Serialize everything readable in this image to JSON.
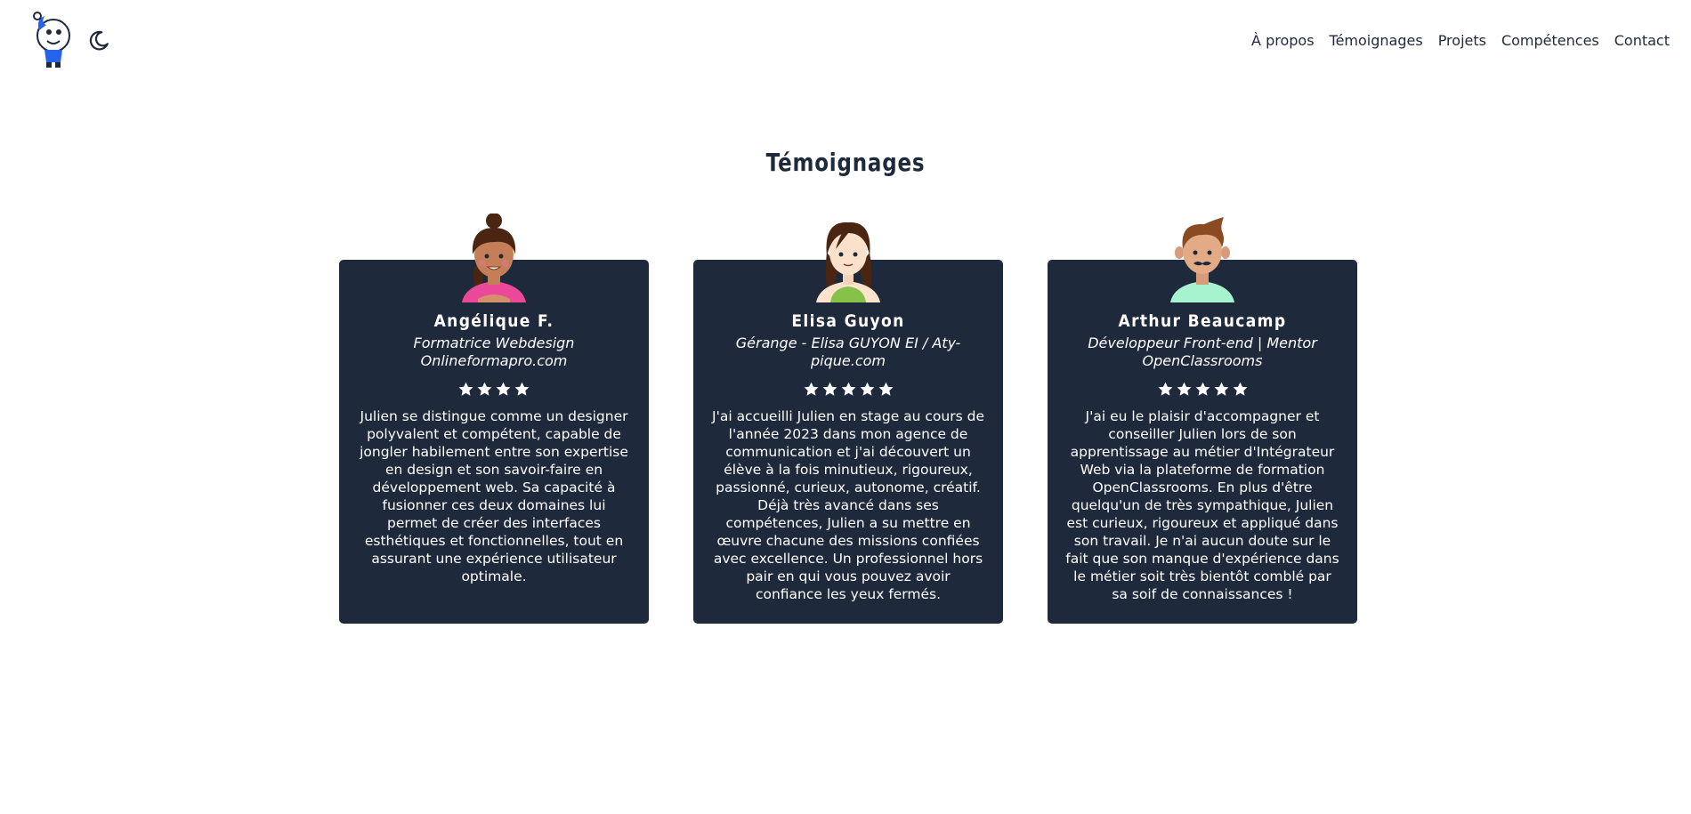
{
  "header": {
    "logo_icon": "cartoon-mascot-logo",
    "theme_icon": "moon-icon",
    "nav": [
      "À propos",
      "Témoignages",
      "Projets",
      "Compétences",
      "Contact"
    ]
  },
  "testimonials": {
    "title": "Témoignages",
    "cards": [
      {
        "avatar_icon": "woman-bun-avatar",
        "name": "Angélique F.",
        "role": "Formatrice Webdesign Onlineformapro.com",
        "rating": 4,
        "text": "Julien se distingue comme un designer polyvalent et compétent, capable de jongler habilement entre son expertise en design et son savoir-faire en développement web. Sa capacité à fusionner ces deux domaines lui permet de créer des interfaces esthétiques et fonctionnelles, tout en assurant une expérience utilisateur optimale."
      },
      {
        "avatar_icon": "woman-long-hair-avatar",
        "name": "Elisa Guyon",
        "role": "Gérange - Elisa GUYON EI / Aty-pique.com",
        "rating": 5,
        "text": "J'ai accueilli Julien en stage au cours de l'année 2023 dans mon agence de communication et j'ai découvert un élève à la fois minutieux, rigoureux, passionné, curieux, autonome, créatif. Déjà très avancé dans ses compétences, Julien a su mettre en œuvre chacune des missions confiées avec excellence. Un professionnel hors pair en qui vous pouvez avoir confiance les yeux fermés."
      },
      {
        "avatar_icon": "man-mustache-avatar",
        "name": "Arthur Beaucamp",
        "role": "Développeur Front-end | Mentor OpenClassrooms",
        "rating": 5,
        "text": "J'ai eu le plaisir d'accompagner et conseiller Julien lors de son apprentissage au métier d'Intégrateur Web via la plateforme de formation OpenClassrooms. En plus d'être quelqu'un de très sympathique, Julien est curieux, rigoureux et appliqué dans son travail. Je n'ai aucun doute sur le fait que son manque d'expérience dans le métier soit très bientôt comblé par sa soif de connaissances !"
      }
    ]
  }
}
